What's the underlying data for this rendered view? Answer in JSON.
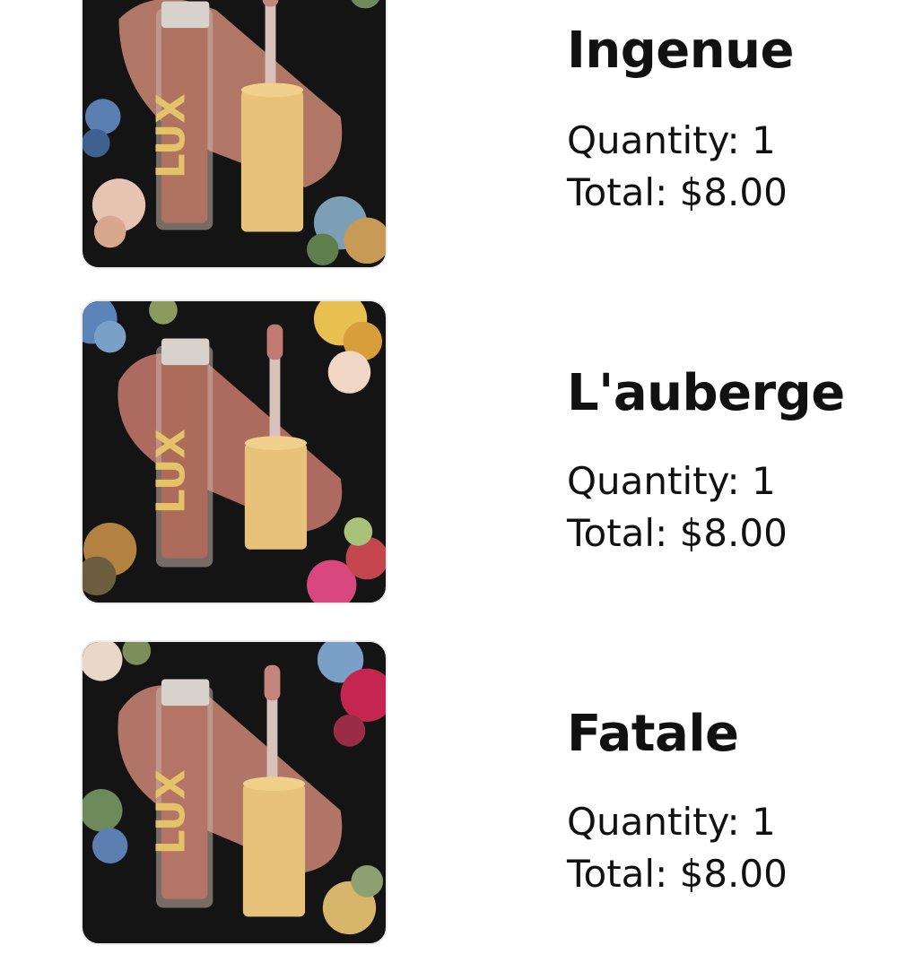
{
  "cart": {
    "items": [
      {
        "name": "Ingenue",
        "quantity_text": "Quantity: 1",
        "total_text": "Total: $8.00",
        "product_image": {
          "brand_text": "LUX",
          "swatch_color": "#b87c6b",
          "liquid_color": "#b07362",
          "cap_color": "#e8c27a",
          "background_color": "#141414"
        }
      },
      {
        "name": "L'auberge",
        "quantity_text": "Quantity: 1",
        "total_text": "Total: $8.00",
        "product_image": {
          "brand_text": "LUX",
          "swatch_color": "#b56f63",
          "liquid_color": "#ad6b5c",
          "cap_color": "#e8c27a",
          "background_color": "#141414"
        }
      },
      {
        "name": "Fatale",
        "quantity_text": "Quantity: 1",
        "total_text": "Total: $8.00",
        "product_image": {
          "brand_text": "LUX",
          "swatch_color": "#b97a6c",
          "liquid_color": "#b57566",
          "cap_color": "#e8c27a",
          "background_color": "#141414"
        }
      }
    ]
  }
}
